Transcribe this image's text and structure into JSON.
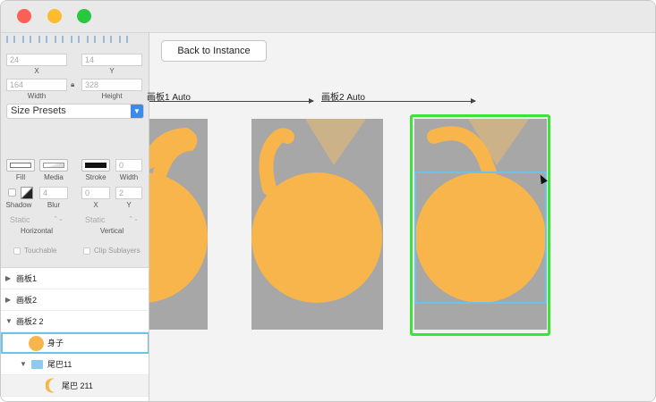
{
  "window": {
    "controls": [
      "close",
      "minimize",
      "zoom"
    ]
  },
  "inspector": {
    "x_value": "24",
    "y_value": "14",
    "x_label": "X",
    "y_label": "Y",
    "width_value": "164",
    "height_value": "328",
    "width_label": "Width",
    "height_label": "Height",
    "size_presets": "Size Presets",
    "fill_label": "Fill",
    "media_label": "Media",
    "stroke_label": "Stroke",
    "stroke_width_value": "0",
    "stroke_width_label": "Width",
    "shadow_label": "Shadow",
    "blur_value": "4",
    "blur_label": "Blur",
    "shadow_x_value": "0",
    "shadow_y_value": "2",
    "shadow_x_label": "X",
    "shadow_y_label": "Y",
    "horizontal_value": "Static",
    "vertical_value": "Static",
    "horizontal_label": "Horizontal",
    "vertical_label": "Vertical",
    "touchable_label": "Touchable",
    "clip_label": "Clip Sublayers"
  },
  "layers": [
    {
      "name": "画板1",
      "expanded": false
    },
    {
      "name": "画板2",
      "expanded": false
    },
    {
      "name": "画板2 2",
      "expanded": true
    },
    {
      "name": "身子"
    },
    {
      "name": "尾巴11",
      "expanded": true
    },
    {
      "name": "尾巴 211"
    }
  ],
  "canvas": {
    "back_button": "Back to Instance",
    "flow1_label": "画板1 Auto",
    "flow2_label": "画板2 Auto",
    "colors": {
      "body": "#f7b54c",
      "board": "#a7a7a7",
      "selected_frame": "#3ee33a",
      "selection": "#6cc3ea"
    }
  }
}
